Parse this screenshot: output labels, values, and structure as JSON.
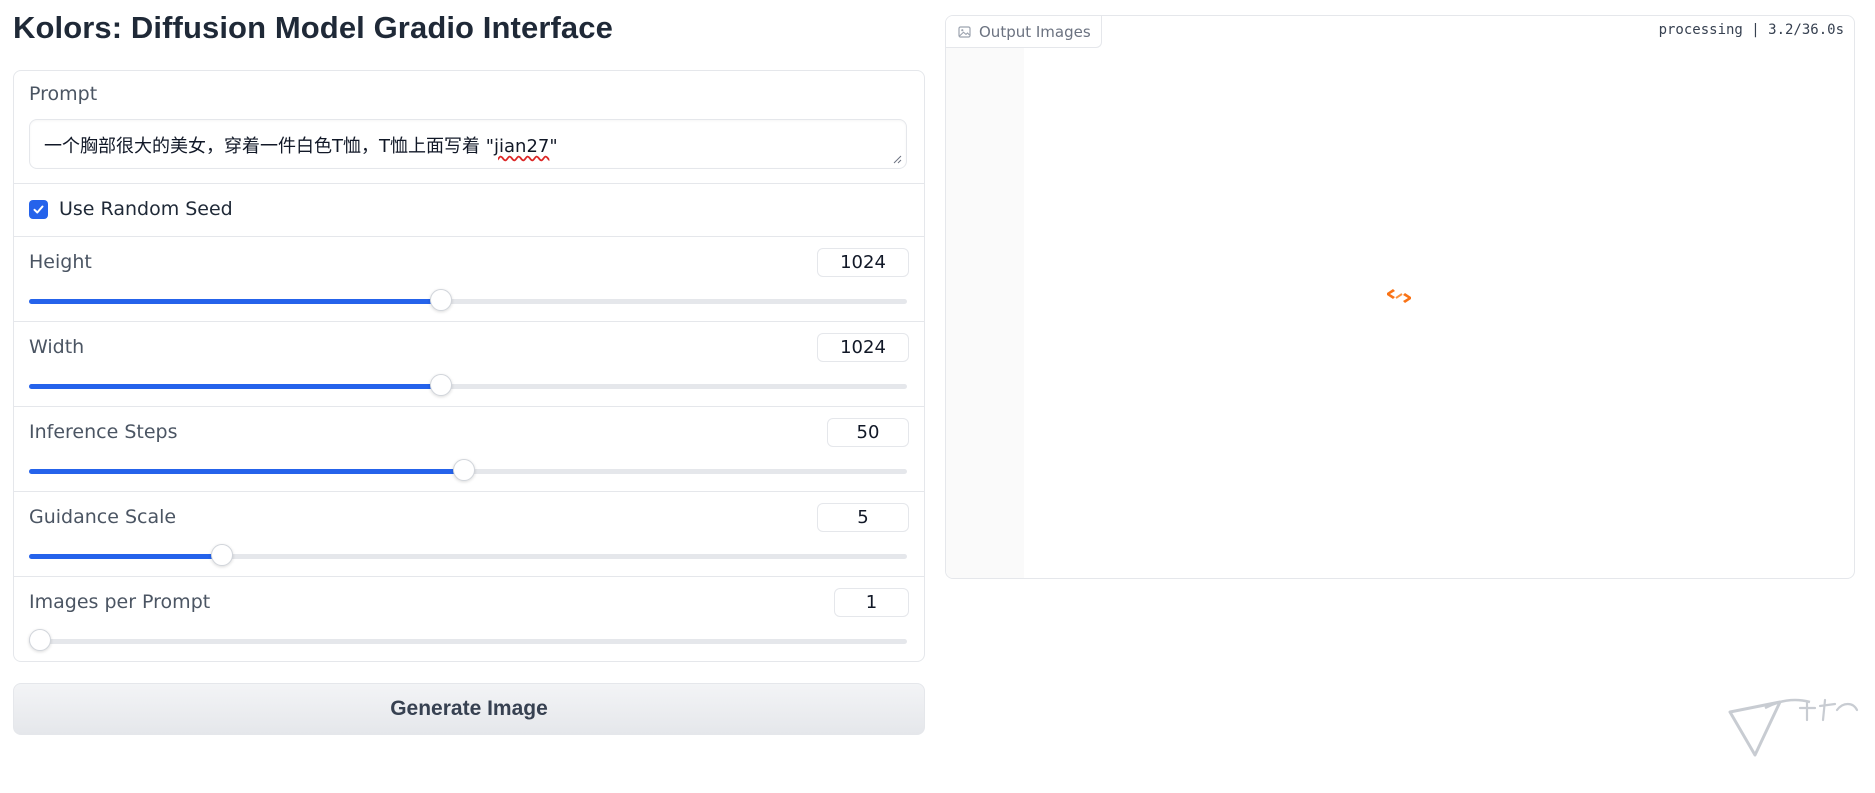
{
  "page": {
    "title": "Kolors: Diffusion Model Gradio Interface"
  },
  "prompt": {
    "label": "Prompt",
    "value_main": "一个胸部很大的美女，穿着一件白色T恤，T恤上面写着 \"",
    "value_underlined": "jian27",
    "value_end": "\""
  },
  "random_seed": {
    "label": "Use Random Seed",
    "checked": true
  },
  "sliders": {
    "height": {
      "label": "Height",
      "value": "1024",
      "fraction": 0.469
    },
    "width": {
      "label": "Width",
      "value": "1024",
      "fraction": 0.469
    },
    "steps": {
      "label": "Inference Steps",
      "value": "50",
      "fraction": 0.495
    },
    "guidance": {
      "label": "Guidance Scale",
      "value": "5",
      "fraction": 0.22
    },
    "images": {
      "label": "Images per Prompt",
      "value": "1",
      "fraction": 0.0
    }
  },
  "generate_button": {
    "label": "Generate Image"
  },
  "output": {
    "tab_label": "Output Images",
    "progress": "processing | 3.2/36.0s",
    "tab_icon": "image-icon",
    "spinner_icon": "loading-spinner-icon"
  },
  "colors": {
    "accent": "#2563eb",
    "spinner": "#f97316",
    "border": "#e5e7eb"
  }
}
